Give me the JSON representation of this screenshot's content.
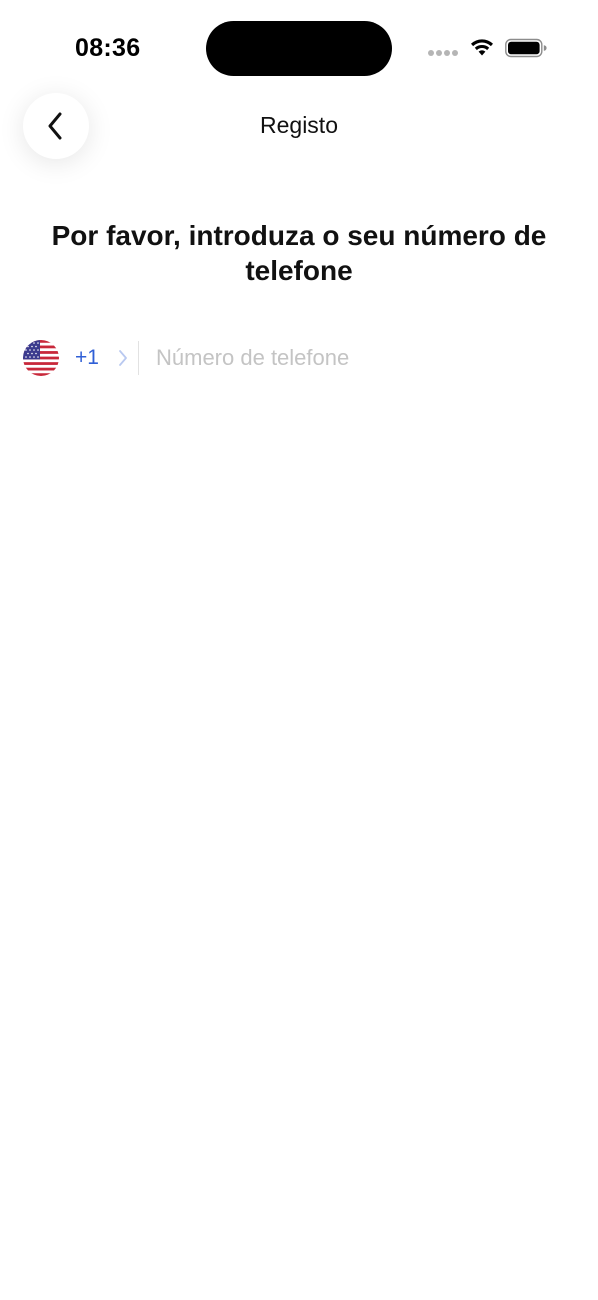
{
  "status_bar": {
    "time": "08:36",
    "icons": [
      "signal-icon",
      "wifi-icon",
      "battery-icon"
    ]
  },
  "nav": {
    "title": "Registo",
    "back_icon": "chevron-left-icon"
  },
  "heading": "Por favor, introduza o seu número de telefone",
  "phone": {
    "country_flag": "us-flag-icon",
    "dial_code": "+1",
    "placeholder": "Número de telefone",
    "value": ""
  },
  "colors": {
    "dial_code": "#2f5fd6",
    "placeholder": "#c4c4c4",
    "text": "#111111"
  }
}
